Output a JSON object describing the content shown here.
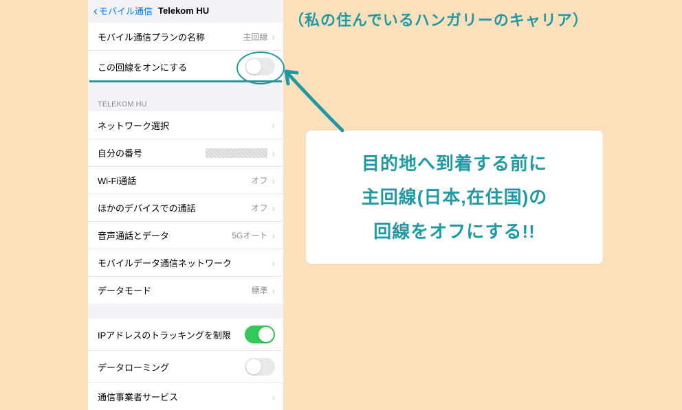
{
  "nav": {
    "back_label": "モバイル通信",
    "title": "Telekom HU"
  },
  "group1": {
    "plan_name_label": "モバイル通信プランの名称",
    "plan_name_value": "主回線",
    "line_on_label": "この回線をオンにする"
  },
  "section_header": "TELEKOM HU",
  "group2": {
    "network_select": "ネットワーク選択",
    "my_number": "自分の番号",
    "wifi_call_label": "Wi-Fi通話",
    "wifi_call_value": "オフ",
    "other_device_label": "ほかのデバイスでの通話",
    "other_device_value": "オフ",
    "voice_data_label": "音声通話とデータ",
    "voice_data_value": "5Gオート",
    "data_network_label": "モバイルデータ通信ネットワーク",
    "data_mode_label": "データモード",
    "data_mode_value": "標準"
  },
  "group3": {
    "ip_tracking_label": "IPアドレスのトラッキングを制限",
    "data_roaming_label": "データローミング",
    "carrier_services_label": "通信事業者サービス"
  },
  "annotations": {
    "top": "（私の住んでいるハンガリーのキャリア）",
    "tip_line1": "目的地へ到着する前に",
    "tip_line2": "主回線(日本,在住国)の",
    "tip_line3": "回線をオフにする!!"
  }
}
